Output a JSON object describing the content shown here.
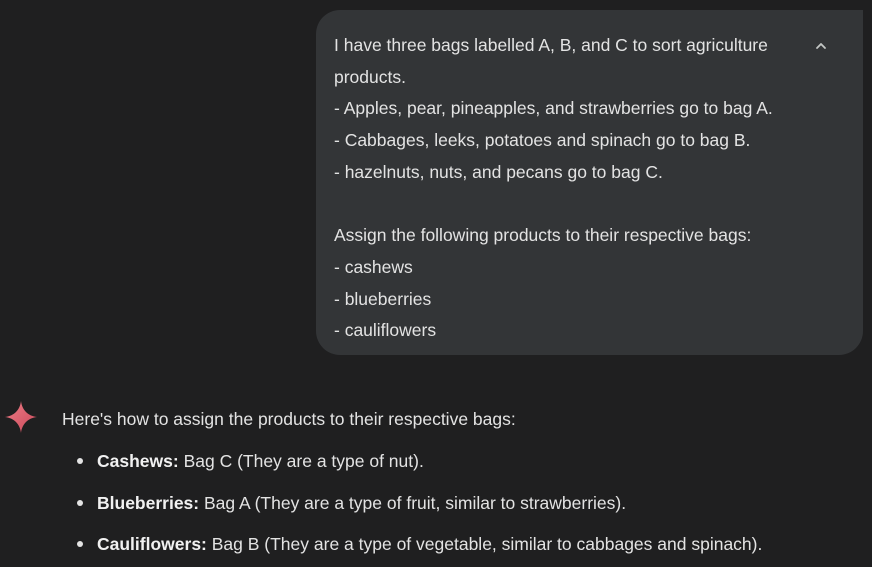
{
  "user_prompt": {
    "lines": [
      "I have three bags labelled A, B, and C to sort agriculture",
      "products.",
      "- Apples, pear, pineapples, and strawberries go to bag A.",
      "- Cabbages, leeks, potatoes and spinach go to bag B.",
      "- hazelnuts, nuts, and pecans go to bag C.",
      "",
      "Assign the following products to their respective bags:",
      "- cashews",
      "- blueberries",
      "- cauliflowers"
    ],
    "collapse_icon": "chevron-up-icon"
  },
  "response": {
    "icon": "gemini-sparkle-icon",
    "intro": "Here's how to assign the products to their respective bags:",
    "items": [
      {
        "term": "Cashews:",
        "text": " Bag C (They are a type of nut)."
      },
      {
        "term": "Blueberries:",
        "text": " Bag A (They are a type of fruit, similar to strawberries)."
      },
      {
        "term": "Cauliflowers:",
        "text": " Bag B (They are a type of vegetable, similar to cabbages and spinach)."
      }
    ]
  },
  "colors": {
    "background": "#1f1f20",
    "bubble": "#333537",
    "text": "#e3e3e3",
    "sparkle_start": "#e8707a",
    "sparkle_end": "#c9485a"
  }
}
